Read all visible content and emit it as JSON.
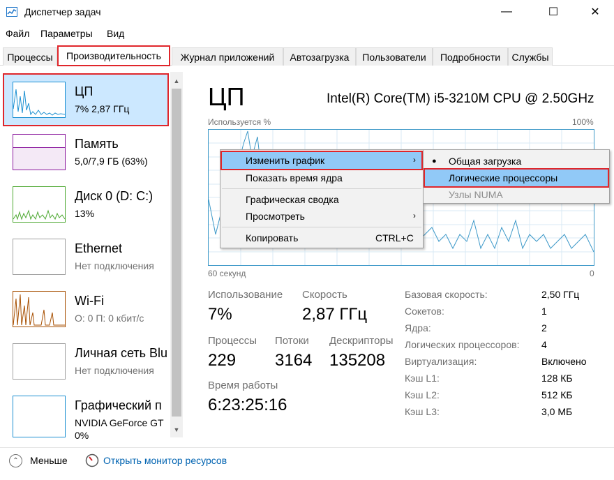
{
  "window": {
    "title": "Диспетчер задач",
    "minimize_glyph": "—",
    "maximize_glyph": "☐",
    "close_glyph": "✕"
  },
  "menu": [
    "Файл",
    "Параметры",
    "Вид"
  ],
  "tabs": [
    "Процессы",
    "Производительность",
    "Журнал приложений",
    "Автозагрузка",
    "Пользователи",
    "Подробности",
    "Службы"
  ],
  "active_tab": "Производительность",
  "sidebar": {
    "items": [
      {
        "name": "ЦП",
        "sub": "7%  2,87 ГГц",
        "color": "#1a8fd1"
      },
      {
        "name": "Память",
        "sub": "5,0/7,9 ГБ (63%)",
        "color": "#8b1a9e"
      },
      {
        "name": "Диск 0 (D: C:)",
        "sub": "13%",
        "color": "#4da831"
      },
      {
        "name": "Ethernet",
        "sub": "Нет подключения",
        "color": "#a0a0a0"
      },
      {
        "name": "Wi-Fi",
        "sub": "О: 0 П: 0 кбит/с",
        "color": "#a74f01"
      },
      {
        "name": "Личная сеть Blu",
        "sub": "Нет подключения",
        "color": "#a0a0a0"
      },
      {
        "name": "Графический п",
        "sub": "NVIDIA GeForce GT",
        "sub2": "0%",
        "color": "#1a8fd1"
      }
    ]
  },
  "main": {
    "title": "ЦП",
    "cpu_name": "Intel(R) Core(TM) i5-3210M CPU @ 2.50GHz",
    "graph_top_left": "Используется %",
    "graph_top_right": "100%",
    "graph_bottom_left": "60 секунд",
    "graph_bottom_right": "0",
    "graph_color": "#3c98c8",
    "stats": {
      "usage_label": "Использование",
      "usage_value": "7%",
      "speed_label": "Скорость",
      "speed_value": "2,87 ГГц",
      "processes_label": "Процессы",
      "processes_value": "229",
      "threads_label": "Потоки",
      "threads_value": "3164",
      "handles_label": "Дескрипторы",
      "handles_value": "135208",
      "uptime_label": "Время работы",
      "uptime_value": "6:23:25:16"
    },
    "info": [
      {
        "label": "Базовая скорость:",
        "value": "2,50 ГГц"
      },
      {
        "label": "Сокетов:",
        "value": "1"
      },
      {
        "label": "Ядра:",
        "value": "2"
      },
      {
        "label": "Логических процессоров:",
        "value": "4"
      },
      {
        "label": "Виртуализация:",
        "value": "Включено"
      },
      {
        "label": "Кэш L1:",
        "value": "128 КБ"
      },
      {
        "label": "Кэш L2:",
        "value": "512 КБ"
      },
      {
        "label": "Кэш L3:",
        "value": "3,0 МБ"
      }
    ]
  },
  "context_menu": {
    "items": [
      {
        "label": "Изменить график",
        "arrow": "›"
      },
      {
        "label": "Показать время ядра"
      },
      {
        "label": "Графическая сводка"
      },
      {
        "label": "Просмотреть",
        "arrow": "›"
      },
      {
        "label": "Копировать",
        "shortcut": "CTRL+C"
      }
    ]
  },
  "submenu": {
    "items": [
      {
        "label": "Общая загрузка",
        "bullet": "●"
      },
      {
        "label": "Логические процессоры"
      },
      {
        "label": "Узлы NUMA"
      }
    ]
  },
  "bottom": {
    "less_label": "Меньше",
    "monitor_link": "Открыть монитор ресурсов"
  }
}
